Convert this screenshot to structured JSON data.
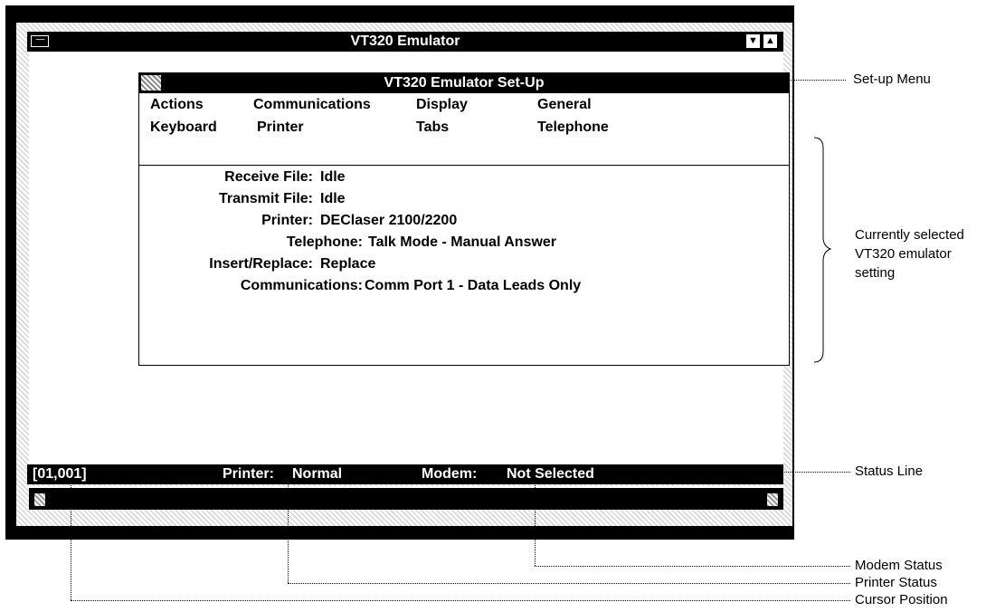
{
  "window": {
    "title": "VT320 Emulator",
    "system_menu_icon": "wave-icon",
    "minimize_icon": "down-arrow-icon",
    "maximize_icon": "up-arrow-icon"
  },
  "setup_dialog": {
    "title": "VT320 Emulator  Set-Up",
    "menu": [
      [
        "Actions",
        "Communications",
        "Display",
        "General"
      ],
      [
        "Keyboard",
        "Printer",
        "Tabs",
        "Telephone"
      ]
    ],
    "rows": [
      {
        "label": "Receive File:",
        "value": "Idle"
      },
      {
        "label": "Transmit File:",
        "value": "Idle"
      },
      {
        "label": "Printer:",
        "value": "DEClaser 2100/2200"
      },
      {
        "label": "Telephone:",
        "value": "Talk Mode - Manual Answer"
      },
      {
        "label": "Insert/Replace:",
        "value": "Replace"
      },
      {
        "label": "Communications:",
        "value": "Comm Port 1 - Data Leads Only"
      }
    ]
  },
  "status_line": {
    "cursor": "[01,001]",
    "printer_label": "Printer:",
    "printer_value": "Normal",
    "modem_label": "Modem:",
    "modem_value": "Not Selected"
  },
  "callouts": {
    "setup_menu": "Set-up Menu",
    "current_setting": [
      "Currently selected",
      "VT320 emulator",
      "setting"
    ],
    "status_line": "Status Line",
    "modem_status": "Modem Status",
    "printer_status": "Printer Status",
    "cursor_position": "Cursor Position"
  }
}
